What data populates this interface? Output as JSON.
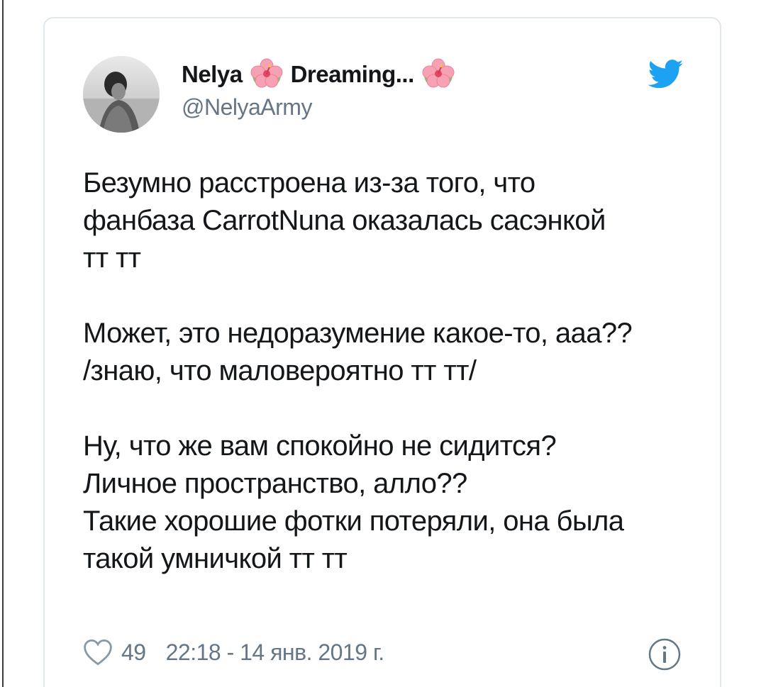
{
  "tweet": {
    "author": {
      "name_part1": "Nelya",
      "name_part2": "Dreaming...",
      "handle": "@NelyaArmy",
      "avatar_icon": "profile-photo",
      "name_emoji": "hibiscus-icon"
    },
    "platform_icon": "twitter-bird-icon",
    "body_lines": [
      "Безумно расстроена из-за того, что",
      "фанбаза CarrotNuna оказалась сасэнкой",
      "тт тт",
      "",
      "Может, это недоразумение какое-то, ааа??",
      "/знаю, что маловероятно тт тт/",
      "",
      "Ну, что же вам спокойно не сидится?",
      "Личное пространство, алло??",
      "Такие хорошие фотки потеряли, она была",
      "такой умничкой тт тт"
    ],
    "likes": "49",
    "timestamp": "22:18 - 14 янв. 2019 г.",
    "colors": {
      "twitter_blue": "#1da1f2",
      "secondary_text": "#657786",
      "border": "#e1e8ed"
    }
  }
}
